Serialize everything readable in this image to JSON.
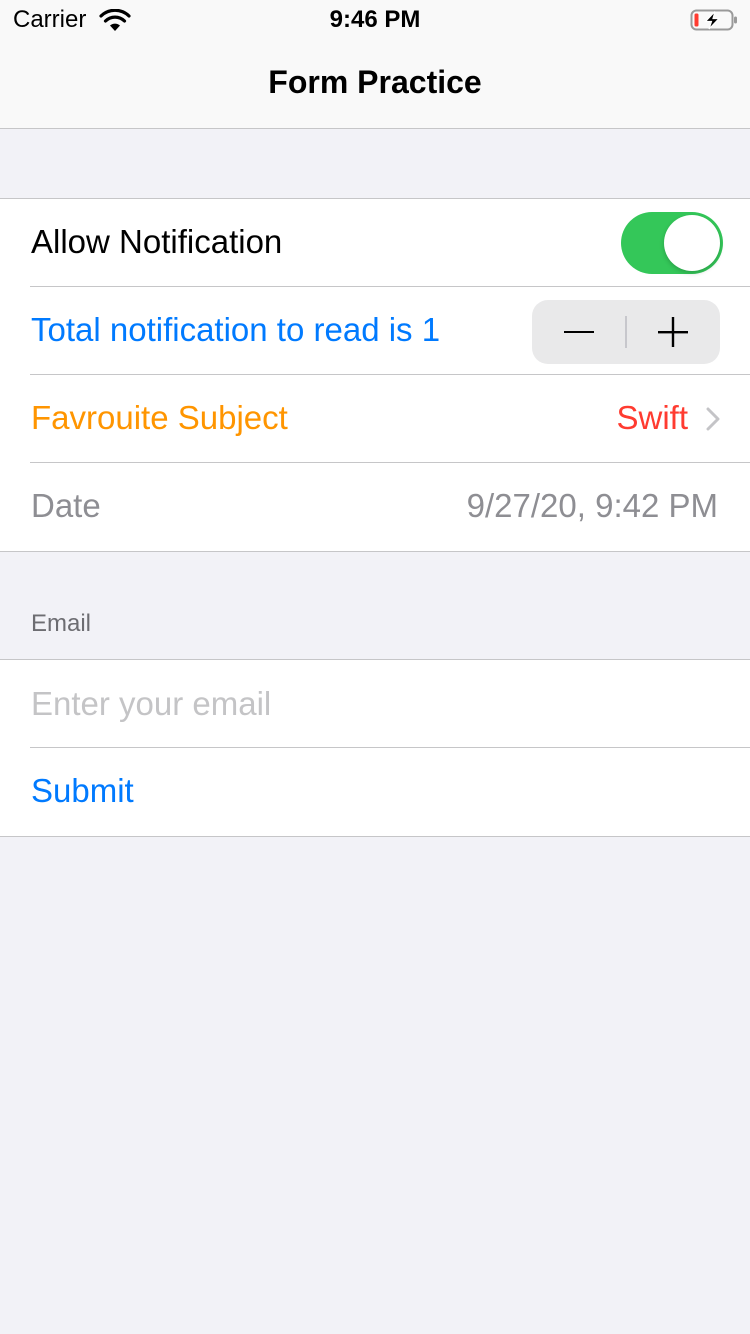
{
  "status_bar": {
    "carrier": "Carrier",
    "time": "9:46 PM",
    "wifi_icon": "wifi-icon",
    "battery_icon": "battery-charging-icon"
  },
  "nav": {
    "title": "Form Practice"
  },
  "settings": {
    "allow_notification_label": "Allow Notification",
    "allow_notification_on": true,
    "stepper_label": "Total notification to read is 1",
    "stepper_value": 1,
    "favourite_label": "Favrouite Subject",
    "favourite_value": "Swift",
    "date_label": "Date",
    "date_value": "9/27/20, 9:42 PM"
  },
  "email_section": {
    "header": "Email",
    "input_value": "",
    "input_placeholder": "Enter your email",
    "submit_label": "Submit"
  },
  "colors": {
    "accent_blue": "#007aff",
    "orange": "#ff9500",
    "red": "#ff3b30",
    "toggle_green": "#34c759",
    "background": "#f2f2f7",
    "secondary_text": "#8e8e93"
  }
}
